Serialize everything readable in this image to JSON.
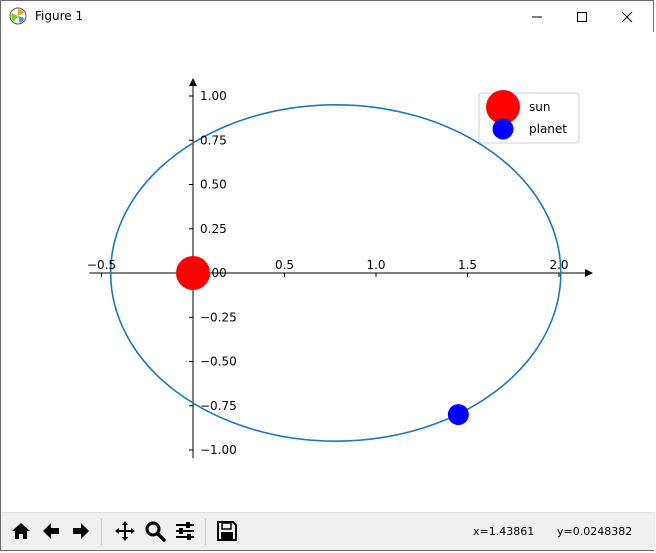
{
  "window": {
    "title": "Figure 1",
    "controls": [
      "minimize",
      "maximize",
      "close"
    ]
  },
  "toolbar": {
    "buttons": [
      {
        "name": "home-button",
        "icon": "home-icon"
      },
      {
        "name": "back-button",
        "icon": "arrow-left-icon"
      },
      {
        "name": "forward-button",
        "icon": "arrow-right-icon"
      },
      {
        "name": "pan-button",
        "icon": "move-icon"
      },
      {
        "name": "zoom-button",
        "icon": "magnifier-icon"
      },
      {
        "name": "configure-subplots-button",
        "icon": "sliders-icon"
      },
      {
        "name": "save-button",
        "icon": "floppy-disk-icon"
      }
    ],
    "x_readout": "x=1.43861",
    "y_readout": "y=0.0248382"
  },
  "chart_data": {
    "type": "scatter",
    "title": "",
    "xlabel": "",
    "ylabel": "",
    "xlim": [
      -0.5,
      2.0
    ],
    "ylim": [
      -1.0,
      1.0
    ],
    "spines": "centered at origin with arrowheads",
    "grid": false,
    "x_ticks": [
      -0.5,
      0.0,
      0.5,
      1.0,
      1.5,
      2.0
    ],
    "x_tick_labels": [
      "−0.5",
      "0.0",
      "0.5",
      "1.0",
      "1.5",
      "2.0"
    ],
    "y_ticks": [
      1.0,
      0.75,
      0.5,
      0.25,
      0.0,
      -0.25,
      -0.5,
      -0.75,
      -1.0
    ],
    "y_tick_labels": [
      "1.00",
      "0.75",
      "0.50",
      "0.25",
      "0.00",
      "−0.25",
      "−0.50",
      "−0.75",
      "−1.00"
    ],
    "orbit": {
      "center_x": 0.78,
      "center_y": 0.0,
      "semi_major": 1.23,
      "semi_minor": 0.95,
      "color": "#1f77b4"
    },
    "series": [
      {
        "name": "sun",
        "x": [
          0.0
        ],
        "y": [
          0.0
        ],
        "color": "#ff0000",
        "marker": "large-circle"
      },
      {
        "name": "planet",
        "x": [
          1.45
        ],
        "y": [
          -0.8
        ],
        "color": "#0000ff",
        "marker": "circle"
      }
    ],
    "legend": {
      "placement": "upper-right",
      "entries": [
        "sun",
        "planet"
      ]
    }
  }
}
